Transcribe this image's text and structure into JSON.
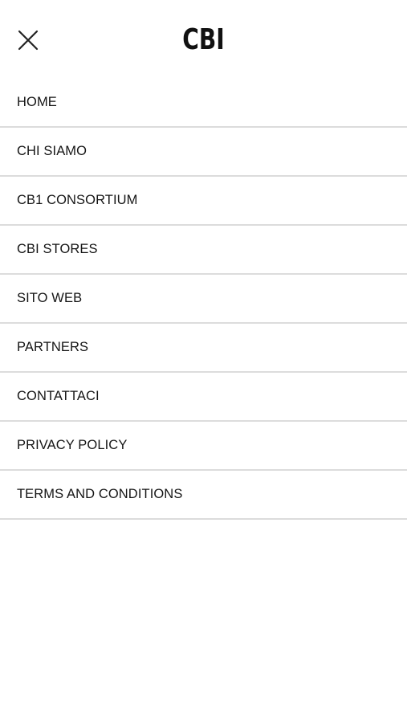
{
  "header": {
    "logo_text": "CBI",
    "close_icon": "close-icon"
  },
  "menu": {
    "items": [
      {
        "label": "HOME"
      },
      {
        "label": "CHI SIAMO"
      },
      {
        "label": "CB1 CONSORTIUM"
      },
      {
        "label": "CBI STORES"
      },
      {
        "label": "SITO WEB"
      },
      {
        "label": "PARTNERS"
      },
      {
        "label": "CONTATTACI"
      },
      {
        "label": "PRIVACY POLICY"
      },
      {
        "label": "TERMS AND CONDITIONS"
      }
    ]
  },
  "colors": {
    "background": "#ffffff",
    "text": "#151515",
    "divider": "#dcdcdc"
  }
}
